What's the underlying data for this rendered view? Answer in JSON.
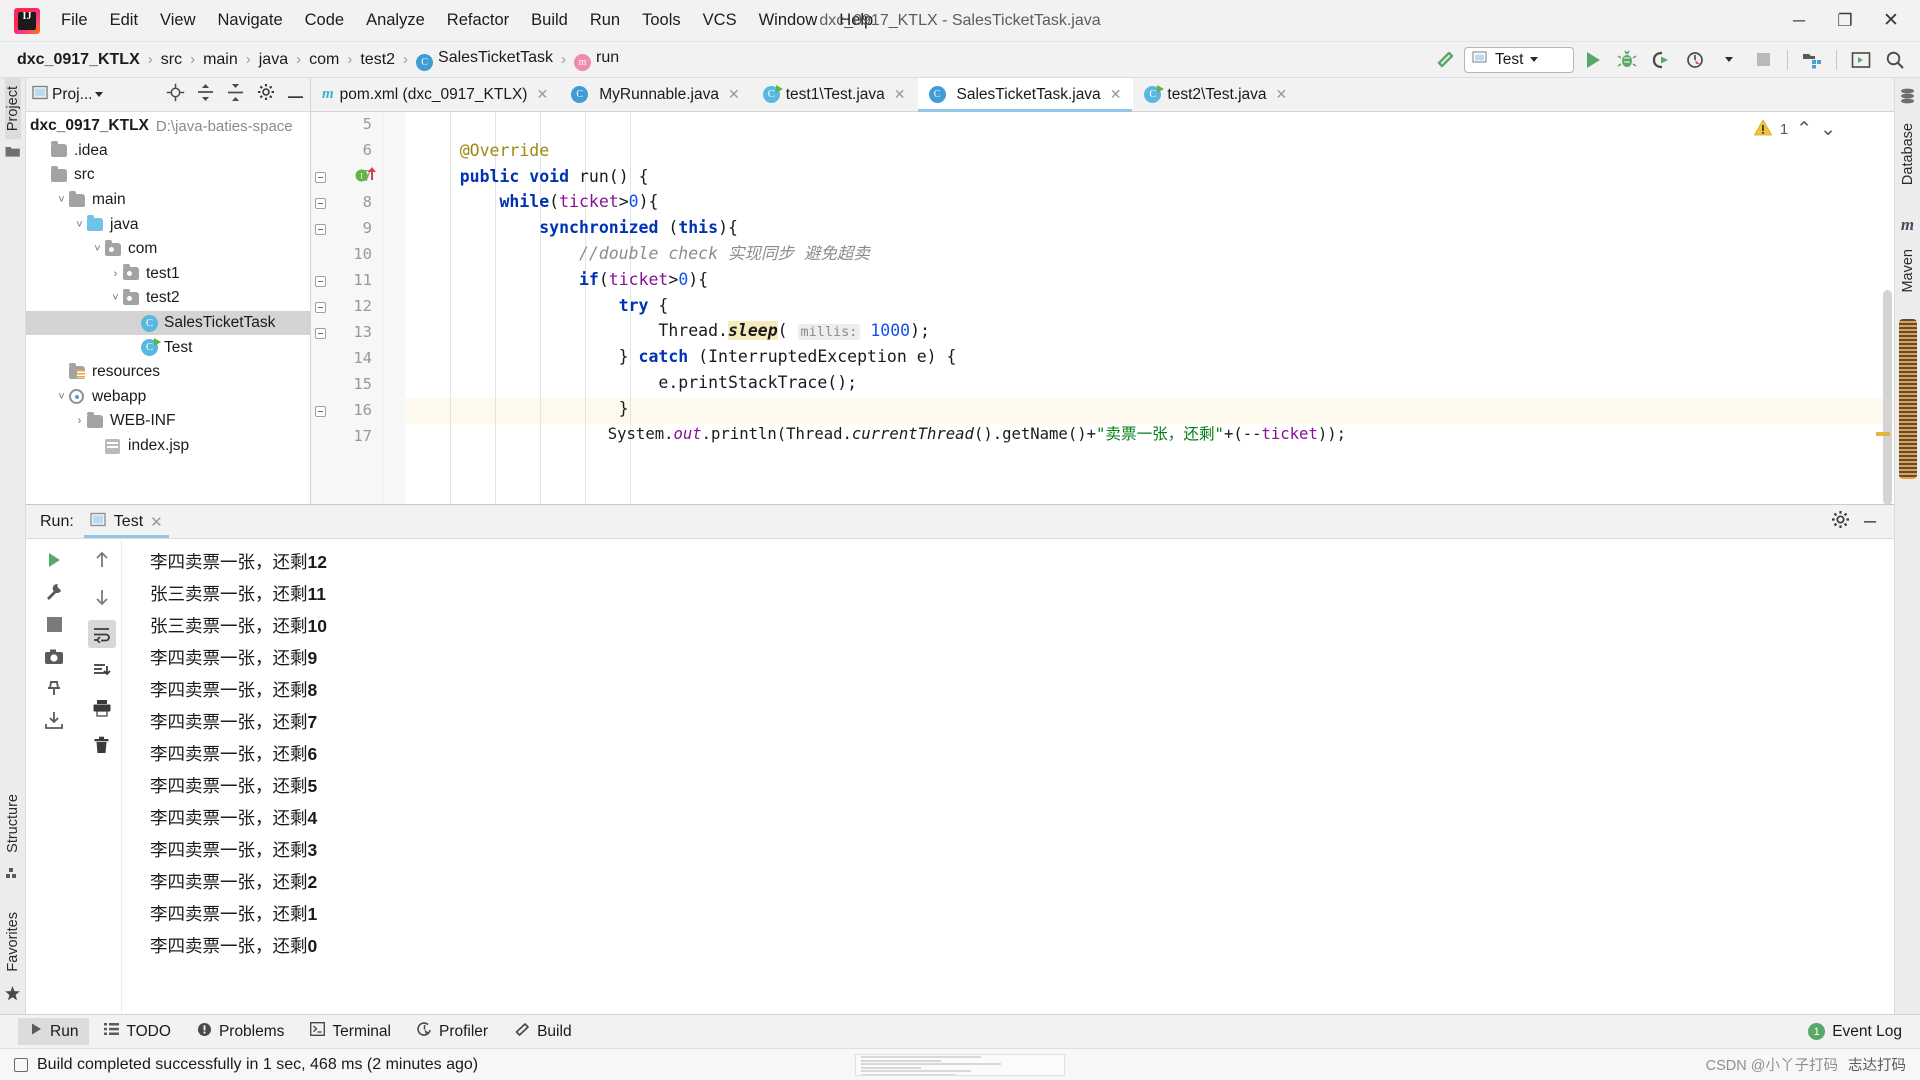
{
  "window": {
    "title": "dxc_0917_KTLX - SalesTicketTask.java",
    "minimize": "─",
    "maximize": "❐",
    "close": "✕"
  },
  "menu": {
    "items": [
      "File",
      "Edit",
      "View",
      "Navigate",
      "Code",
      "Analyze",
      "Refactor",
      "Build",
      "Run",
      "Tools",
      "VCS",
      "Window",
      "Help"
    ]
  },
  "breadcrumb": {
    "items": [
      {
        "label": "dxc_0917_KTLX",
        "icon": "",
        "root": true
      },
      {
        "label": "src",
        "icon": ""
      },
      {
        "label": "main",
        "icon": ""
      },
      {
        "label": "java",
        "icon": ""
      },
      {
        "label": "com",
        "icon": ""
      },
      {
        "label": "test2",
        "icon": ""
      },
      {
        "label": "SalesTicketTask",
        "icon": "C"
      },
      {
        "label": "run",
        "icon": "m"
      }
    ],
    "separator": "›"
  },
  "toolbar": {
    "build_icon": "hammer-icon",
    "run_config": "Test",
    "run_icon": "run-icon",
    "debug_icon": "debug-icon",
    "coverage_icon": "run-with-coverage-icon",
    "profile_icon": "profiler-icon",
    "stop_icon": "stop-icon",
    "project_structure_icon": "project-structure-icon",
    "updates_icon": "updates-icon",
    "search_icon": "search-everywhere-icon"
  },
  "left_strip": {
    "project": "Project",
    "structure": "Structure",
    "favorites": "Favorites"
  },
  "right_strip": {
    "database": "Database",
    "maven": "Maven"
  },
  "project_panel": {
    "title": "Proj...",
    "root": {
      "label": "dxc_0917_KTLX",
      "path": "D:\\java-baties-space"
    },
    "tree": [
      {
        "label": ".idea",
        "depth": 1,
        "arrow": "",
        "icon": "folder",
        "selected": false
      },
      {
        "label": "src",
        "depth": 1,
        "arrow": "",
        "icon": "folder",
        "selected": false
      },
      {
        "label": "main",
        "depth": 2,
        "arrow": "v",
        "icon": "folder",
        "selected": false
      },
      {
        "label": "java",
        "depth": 3,
        "arrow": "v",
        "icon": "folder-blue",
        "selected": false
      },
      {
        "label": "com",
        "depth": 4,
        "arrow": "v",
        "icon": "folder-pkg",
        "selected": false
      },
      {
        "label": "test1",
        "depth": 5,
        "arrow": ">",
        "icon": "folder-pkg",
        "selected": false
      },
      {
        "label": "test2",
        "depth": 5,
        "arrow": "v",
        "icon": "folder-pkg",
        "selected": false
      },
      {
        "label": "SalesTicketTask",
        "depth": 6,
        "arrow": "",
        "icon": "class",
        "selected": true
      },
      {
        "label": "Test",
        "depth": 6,
        "arrow": "",
        "icon": "class-runnable",
        "selected": false
      },
      {
        "label": "resources",
        "depth": 2,
        "arrow": "",
        "icon": "folder-res",
        "selected": false
      },
      {
        "label": "webapp",
        "depth": 2,
        "arrow": "v",
        "icon": "module",
        "selected": false
      },
      {
        "label": "WEB-INF",
        "depth": 3,
        "arrow": ">",
        "icon": "folder",
        "selected": false
      },
      {
        "label": "index.jsp",
        "depth": 4,
        "arrow": "",
        "icon": "jsp",
        "selected": false
      }
    ]
  },
  "editor_tabs": [
    {
      "label": "pom.xml (dxc_0917_KTLX)",
      "icon": "maven-icon",
      "active": false
    },
    {
      "label": "MyRunnable.java",
      "icon": "class-icon",
      "active": false
    },
    {
      "label": "test1\\Test.java",
      "icon": "class-runnable-icon",
      "active": false
    },
    {
      "label": "SalesTicketTask.java",
      "icon": "class-icon",
      "active": true
    },
    {
      "label": "test2\\Test.java",
      "icon": "class-runnable-icon",
      "active": false
    }
  ],
  "editor": {
    "warning_count": "1",
    "warning_icon": "warning-triangle-icon",
    "prev_icon": "⌃",
    "next_icon": "⌄",
    "lines": [
      {
        "num": "5",
        "text": ""
      },
      {
        "num": "6",
        "text": "    @Override"
      },
      {
        "num": "7",
        "text": "    public void run() {"
      },
      {
        "num": "8",
        "text": "        while(ticket>0){"
      },
      {
        "num": "9",
        "text": "            synchronized (this){"
      },
      {
        "num": "10",
        "text": "                //double check 实现同步 避免超卖"
      },
      {
        "num": "11",
        "text": "                if(ticket>0){"
      },
      {
        "num": "12",
        "text": "                    try {"
      },
      {
        "num": "13",
        "text": "                        Thread.sleep( millis: 1000);"
      },
      {
        "num": "14",
        "text": "                    } catch (InterruptedException e) {"
      },
      {
        "num": "15",
        "text": "                        e.printStackTrace();"
      },
      {
        "num": "16",
        "text": "                    }"
      },
      {
        "num": "17",
        "text": "                    System.out.println(Thread.currentThread().getName()+\"卖票一张，还剩\"+(--ticket));"
      }
    ],
    "param_hint": "millis:"
  },
  "run_panel": {
    "label": "Run:",
    "tab": "Test",
    "close_icon": "✕",
    "settings_icon": "gear-icon",
    "minimize_icon": "─",
    "gutter_icons": [
      "rerun-icon",
      "wrench-icon",
      "stop-icon",
      "camera-icon",
      "pin-icon",
      "export-icon"
    ],
    "gutter2_icons": [
      "up-icon",
      "down-icon",
      "soft-wrap-icon",
      "scroll-to-end-icon",
      "print-icon",
      "trash-icon"
    ],
    "console_lines": [
      "李四卖票一张，还剩",
      "张三卖票一张，还剩",
      "张三卖票一张，还剩",
      "李四卖票一张，还剩",
      "李四卖票一张，还剩",
      "李四卖票一张，还剩",
      "李四卖票一张，还剩",
      "李四卖票一张，还剩",
      "李四卖票一张，还剩",
      "李四卖票一张，还剩",
      "李四卖票一张，还剩",
      "李四卖票一张，还剩",
      "李四卖票一张，还剩"
    ],
    "console_counts": [
      "12",
      "11",
      "10",
      "9",
      "8",
      "7",
      "6",
      "5",
      "4",
      "3",
      "2",
      "1",
      "0"
    ]
  },
  "bottom_bar": {
    "items": [
      {
        "label": "Run",
        "icon": "run-icon",
        "active": true
      },
      {
        "label": "TODO",
        "icon": "todo-icon",
        "active": false
      },
      {
        "label": "Problems",
        "icon": "problems-icon",
        "active": false
      },
      {
        "label": "Terminal",
        "icon": "terminal-icon",
        "active": false
      },
      {
        "label": "Profiler",
        "icon": "profiler-icon",
        "active": false
      },
      {
        "label": "Build",
        "icon": "build-icon",
        "active": false
      }
    ],
    "event_log": "Event Log",
    "event_badge": "1"
  },
  "status_bar": {
    "message": "Build completed successfully in 1 sec, 468 ms (2 minutes ago)",
    "watermark": "CSDN @小丫子打码",
    "ime": "志达打码"
  },
  "colors": {
    "accent": "#4b9fd5",
    "green": "#59a869",
    "warning": "#ddb83a",
    "keyword": "#0033b3",
    "string": "#067d17",
    "field": "#871094",
    "number": "#1750eb"
  }
}
